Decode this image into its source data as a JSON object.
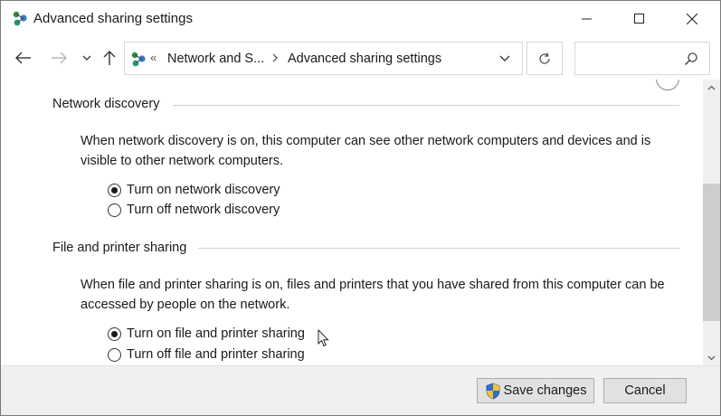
{
  "window": {
    "title": "Advanced sharing settings",
    "icon": "network-sharing-icon"
  },
  "title_buttons": {
    "minimize": "minimize-icon",
    "maximize": "maximize-icon",
    "close": "close-icon"
  },
  "address_bar": {
    "overflow_marker": "«",
    "segments": [
      "Network and S...",
      "Advanced sharing settings"
    ],
    "search_placeholder": ""
  },
  "sections": [
    {
      "heading": "Network discovery",
      "description": "When network discovery is on, this computer can see other network computers and devices and is visible to other network computers.",
      "options": [
        {
          "label": "Turn on network discovery",
          "selected": true
        },
        {
          "label": "Turn off network discovery",
          "selected": false
        }
      ]
    },
    {
      "heading": "File and printer sharing",
      "description": "When file and printer sharing is on, files and printers that you have shared from this computer can be accessed by people on the network.",
      "options": [
        {
          "label": "Turn on file and printer sharing",
          "selected": true
        },
        {
          "label": "Turn off file and printer sharing",
          "selected": false
        }
      ]
    }
  ],
  "footer": {
    "save_label": "Save changes",
    "cancel_label": "Cancel"
  },
  "colors": {
    "footer_bg": "#f0f0f0",
    "button_bg": "#e1e1e1",
    "shield_blue": "#2f6fd0",
    "shield_yellow": "#f2c230"
  }
}
